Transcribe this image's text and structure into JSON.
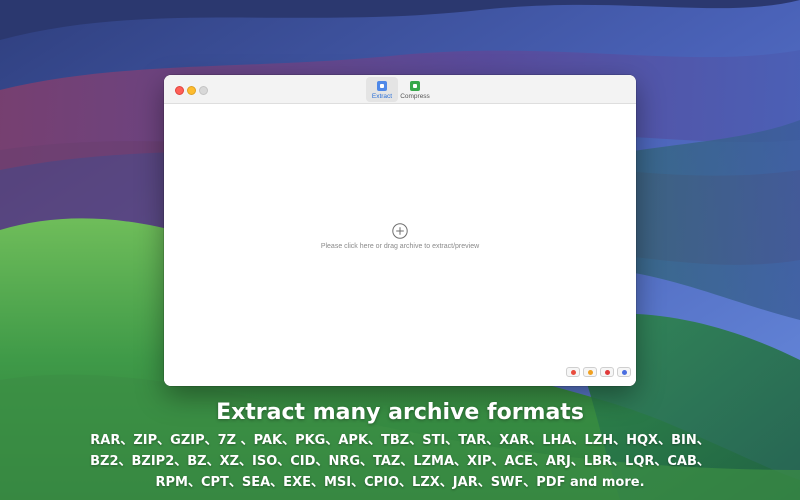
{
  "colors": {
    "accent": "#2b6fd6",
    "extract_icon": "#4e88e8",
    "compress_icon": "#36a84a",
    "close": "#fe5f57",
    "minimize": "#febc2e",
    "zoom_inactive": "#d8d8d8"
  },
  "window": {
    "tabs": [
      {
        "label": "Extract",
        "icon": "archive-box-icon",
        "selected": true
      },
      {
        "label": "Compress",
        "icon": "compress-box-icon",
        "selected": false
      }
    ]
  },
  "main": {
    "add_icon": "plus-circle-icon",
    "hint": "Please click here or drag archive to extract/preview"
  },
  "footer_buttons": [
    {
      "icon": "cart-icon",
      "color": "#e84c3d"
    },
    {
      "icon": "smiley-icon",
      "color": "#f0a020"
    },
    {
      "icon": "star-icon",
      "color": "#e03a3a"
    },
    {
      "icon": "settings-icon",
      "color": "#4a6ee0"
    }
  ],
  "promo": {
    "title": "Extract many archive formats",
    "formats_line1": "RAR、ZIP、GZIP、7Z 、PAK、PKG、APK、TBZ、STI、TAR、XAR、LHA、LZH、HQX、BIN、",
    "formats_line2": "BZ2、BZIP2、BZ、XZ、ISO、CID、NRG、TAZ、LZMA、XIP、ACE、ARJ、LBR、LQR、CAB、",
    "formats_line3": "RPM、CPT、SEA、EXE、MSI、CPIO、LZX、JAR、SWF、PDF and more."
  }
}
